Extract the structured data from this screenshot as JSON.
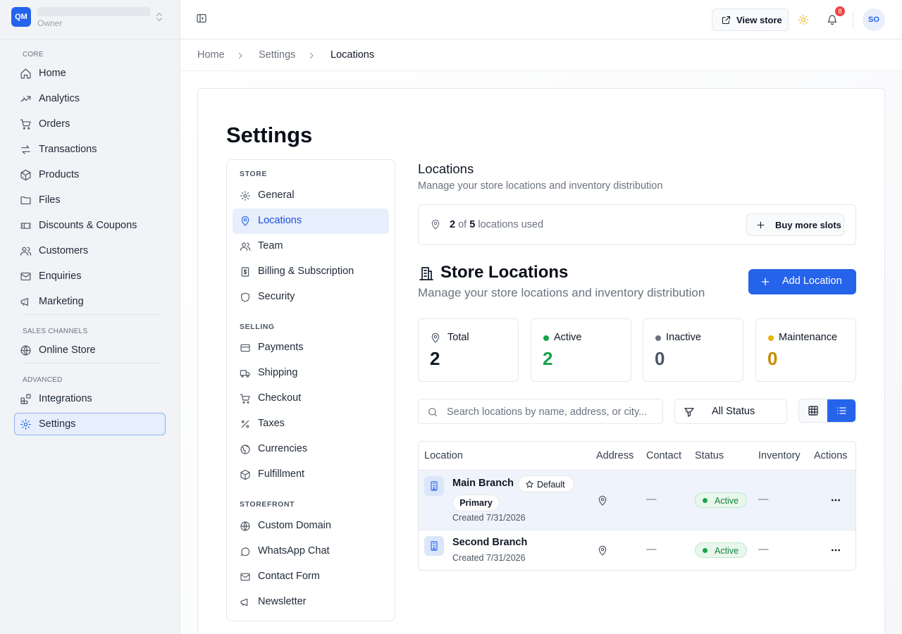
{
  "org": {
    "initials": "QM",
    "role": "Owner"
  },
  "sidebar": {
    "sections": {
      "core": "CORE",
      "sales": "SALES CHANNELS",
      "advanced": "ADVANCED"
    },
    "items": {
      "home": "Home",
      "analytics": "Analytics",
      "orders": "Orders",
      "transactions": "Transactions",
      "products": "Products",
      "files": "Files",
      "discounts": "Discounts & Coupons",
      "customers": "Customers",
      "enquiries": "Enquiries",
      "marketing": "Marketing",
      "online_store": "Online Store",
      "integrations": "Integrations",
      "settings": "Settings"
    },
    "active": "settings"
  },
  "topbar": {
    "view_store": "View store",
    "notifications": "8",
    "avatar": "SO"
  },
  "breadcrumb": [
    "Home",
    "Settings",
    "Locations"
  ],
  "page_title": "Settings",
  "settings_nav": {
    "sections": {
      "store": "STORE",
      "selling": "SELLING",
      "storefront": "STOREFRONT"
    },
    "items": {
      "general": "General",
      "locations": "Locations",
      "team": "Team",
      "billing": "Billing & Subscription",
      "security": "Security",
      "payments": "Payments",
      "shipping": "Shipping",
      "checkout": "Checkout",
      "taxes": "Taxes",
      "currencies": "Currencies",
      "fulfillment": "Fulfillment",
      "custom_domain": "Custom Domain",
      "whatsapp": "WhatsApp Chat",
      "contact_form": "Contact Form",
      "newsletter": "Newsletter"
    },
    "active": "locations"
  },
  "locations": {
    "title": "Locations",
    "subtitle": "Manage your store locations and inventory distribution",
    "usage": {
      "used": "2",
      "of": "of",
      "total": "5",
      "suffix": "locations used"
    },
    "buy_more": "Buy more slots",
    "store_title": "Store Locations",
    "store_subtitle": "Manage your store locations and inventory distribution",
    "add_button": "Add Location",
    "stats": {
      "total": {
        "label": "Total",
        "value": "2"
      },
      "active": {
        "label": "Active",
        "value": "2",
        "color": "#16a34a"
      },
      "inactive": {
        "label": "Inactive",
        "value": "0",
        "color": "#6b7280"
      },
      "maintenance": {
        "label": "Maintenance",
        "value": "0",
        "color": "#eab308"
      }
    },
    "search_placeholder": "Search locations by name, address, or city...",
    "status_filter": "All Status",
    "table": {
      "headers": {
        "location": "Location",
        "address": "Address",
        "contact": "Contact",
        "status": "Status",
        "inventory": "Inventory",
        "actions": "Actions"
      },
      "rows": [
        {
          "name": "Main Branch",
          "default_tag": "Default",
          "primary_tag": "Primary",
          "created": "Created 7/31/2026",
          "contact": "—",
          "status": "Active",
          "inventory": "—"
        },
        {
          "name": "Second Branch",
          "created": "Created 7/31/2026",
          "contact": "—",
          "status": "Active",
          "inventory": "—"
        }
      ]
    }
  },
  "colors": {
    "accent": "#2563eb",
    "active_nav_bg": "#e7eefc",
    "success": "#16a34a"
  }
}
